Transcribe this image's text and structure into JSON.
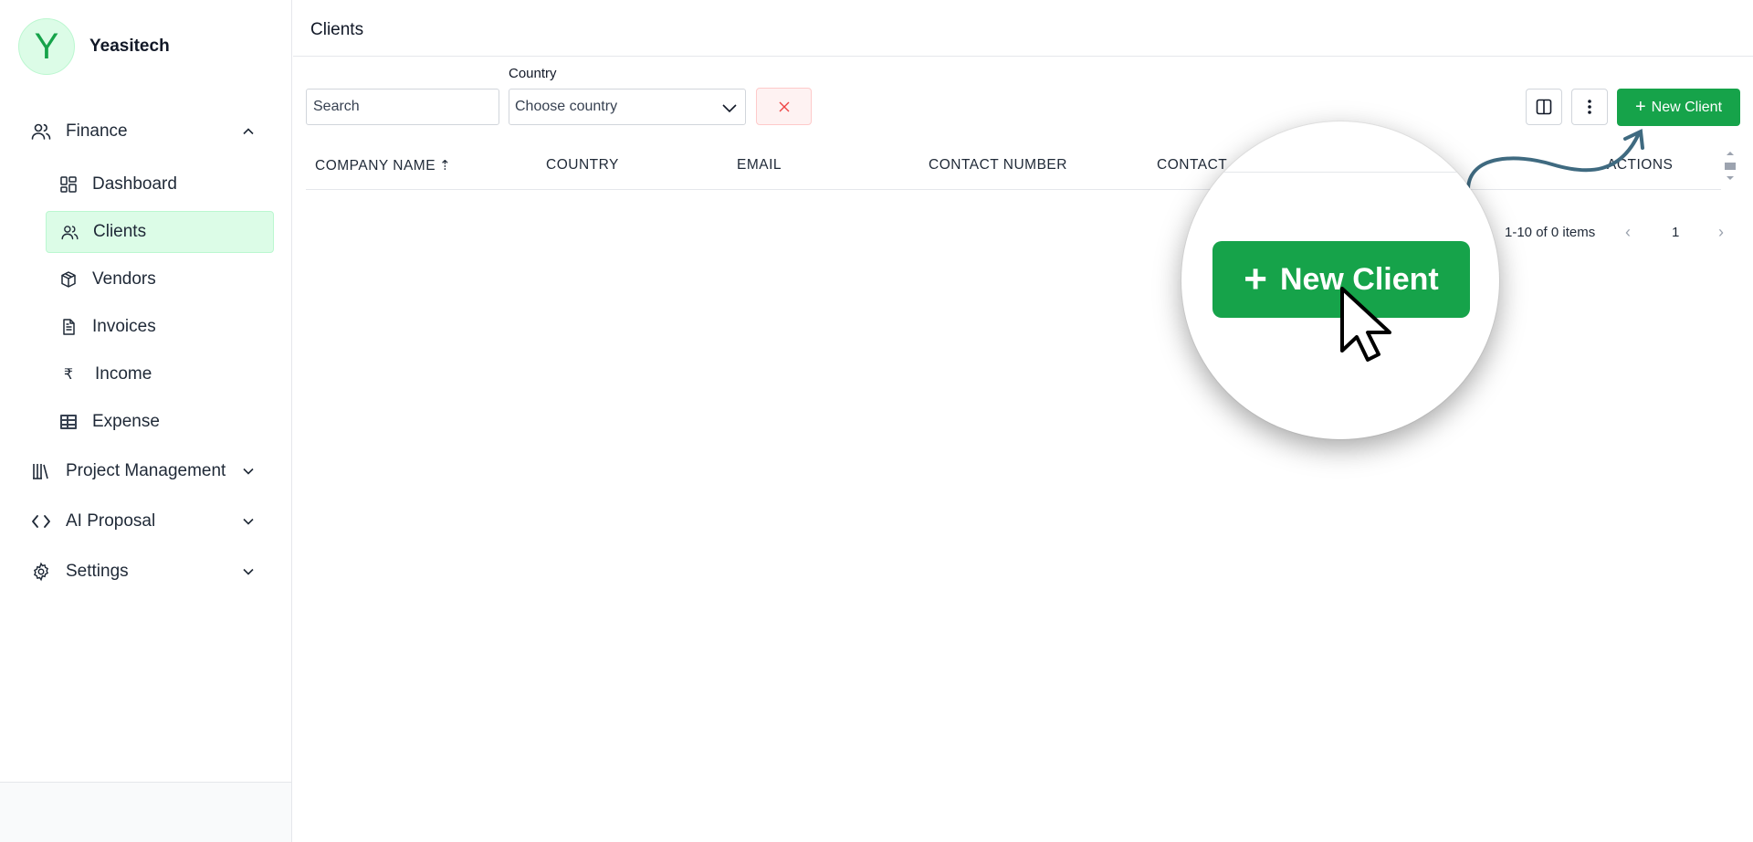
{
  "brand": {
    "initial": "Y",
    "name": "Yeasitech"
  },
  "sidebar": {
    "finance": {
      "label": "Finance",
      "icon": "users-icon",
      "expanded": true
    },
    "finance_items": [
      {
        "label": "Dashboard",
        "icon": "dashboard-grid-icon",
        "active": false
      },
      {
        "label": "Clients",
        "icon": "users-icon",
        "active": true
      },
      {
        "label": "Vendors",
        "icon": "box-icon",
        "active": false
      },
      {
        "label": "Invoices",
        "icon": "document-icon",
        "active": false
      },
      {
        "label": "Income",
        "icon": "rupee-icon",
        "active": false
      },
      {
        "label": "Expense",
        "icon": "ledger-icon",
        "active": false
      }
    ],
    "groups": [
      {
        "label": "Project Management",
        "icon": "library-icon"
      },
      {
        "label": "AI Proposal",
        "icon": "code-icon"
      },
      {
        "label": "Settings",
        "icon": "gear-icon"
      }
    ]
  },
  "header": {
    "title": "Clients"
  },
  "filters": {
    "search_placeholder": "Search",
    "country_label": "Country",
    "country_placeholder": "Choose country"
  },
  "toolbar": {
    "new_client_label": "New Client"
  },
  "table": {
    "columns": [
      "COMPANY NAME",
      "COUNTRY",
      "EMAIL",
      "CONTACT NUMBER",
      "CONTACT",
      "ACTIONS"
    ],
    "sort_column": "COMPANY NAME",
    "rows": []
  },
  "pagination": {
    "summary": "1-10 of 0 items",
    "current_page": "1"
  },
  "callout": {
    "button_label": "New Client"
  },
  "colors": {
    "accent": "#16a34a",
    "accent_light": "#dcfce7",
    "danger_light": "#fef2f2",
    "arrow": "#3f6a80"
  }
}
